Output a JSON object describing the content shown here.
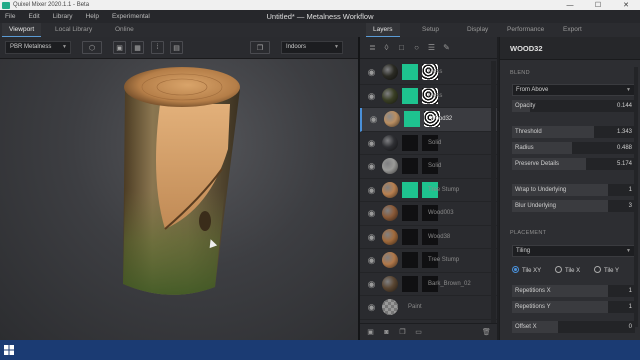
{
  "titlebar": {
    "title": "Quixel Mixer 2020.1.1 - Beta",
    "minimize": "—",
    "maximize": "☐",
    "close": "✕"
  },
  "menubar": {
    "items": [
      "File",
      "Edit",
      "Library",
      "Help",
      "Experimental"
    ],
    "doc_title": "Untitled* — Metalness Workflow"
  },
  "left_tabs": [
    "Viewport",
    "Local Library",
    "Online"
  ],
  "right_tabs": [
    "Layers",
    "Setup",
    "Display",
    "Performance",
    "Export"
  ],
  "viewport_toolbar": {
    "render_mode": "PBR Metalness",
    "environment": "Indoors"
  },
  "layers": [
    {
      "name": "Moss",
      "ball": "#2b2b24",
      "t1": "#1ec38f",
      "t2": "#ffffff",
      "selected": false
    },
    {
      "name": "Moss",
      "ball": "#3a3f25",
      "t1": "#1ec38f",
      "t2": "#ffffff",
      "selected": false
    },
    {
      "name": "Wood32",
      "ball": "#b98e62",
      "t1": "#1ec38f",
      "t2": "#e8e8e8",
      "selected": true
    },
    {
      "name": "Solid",
      "ball": "#2e2f33",
      "t1": "#101012",
      "t2": "#101012",
      "selected": false
    },
    {
      "name": "Solid",
      "ball": "#9a9a98",
      "t1": "#101012",
      "t2": "#101012",
      "selected": false
    },
    {
      "name": "Tree Stump",
      "ball": "#b88050",
      "t1": "#1ec38f",
      "t2": "#1ec38f",
      "selected": false
    },
    {
      "name": "Wood003",
      "ball": "#8a5a38",
      "t1": "#101012",
      "t2": "#101012",
      "selected": false
    },
    {
      "name": "Wood38",
      "ball": "#a06a3c",
      "t1": "#101012",
      "t2": "#101012",
      "selected": false
    },
    {
      "name": "Tree Stump",
      "ball": "#b0784a",
      "t1": "#101012",
      "t2": "#101012",
      "selected": false
    },
    {
      "name": "Bark_Brown_02",
      "ball": "#5a4632",
      "t1": "#101012",
      "t2": "#101012",
      "selected": false
    },
    {
      "name": "Paint",
      "ball": "#888888",
      "t1": "",
      "t2": "",
      "selected": false
    }
  ],
  "props": {
    "header": "WOOD32",
    "blend_section": "BLEND",
    "blend_mode": "From Above",
    "rows": [
      {
        "label": "Opacity",
        "value": "0.144",
        "fill": 0.144
      },
      {
        "label": "Threshold",
        "value": "1.343",
        "fill": 0.67
      },
      {
        "label": "Radius",
        "value": "0.488",
        "fill": 0.49
      },
      {
        "label": "Preserve Details",
        "value": "5.174",
        "fill": 0.6
      },
      {
        "label": "Wrap to Underlying",
        "value": "1",
        "fill": 0.78
      },
      {
        "label": "Blur Underlying",
        "value": "3",
        "fill": 0.78
      }
    ],
    "placement_section": "PLACEMENT",
    "placement_mode": "Tiling",
    "tile_options": [
      "Tile XY",
      "Tile X",
      "Tile Y"
    ],
    "rows2": [
      {
        "label": "Repetitions X",
        "value": "1",
        "fill": 0.78
      },
      {
        "label": "Repetitions Y",
        "value": "1",
        "fill": 0.78
      },
      {
        "label": "Offset X",
        "value": "0",
        "fill": 0.37
      }
    ]
  },
  "colors": {
    "accent": "#4a90d9",
    "taskbar": "#1b3b73",
    "mask_green": "#1ec38f"
  }
}
